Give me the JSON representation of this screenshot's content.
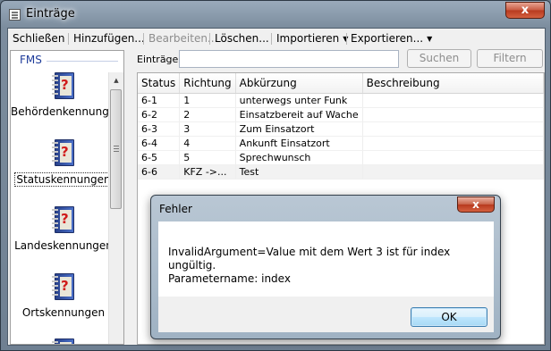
{
  "window": {
    "title": "Einträge",
    "close_glyph": "x"
  },
  "menu": {
    "items": [
      {
        "label": "Schließen",
        "enabled": true
      },
      {
        "label": "Hinzufügen...",
        "enabled": true
      },
      {
        "label": "Bearbeiten...",
        "enabled": false
      },
      {
        "label": "Löschen...",
        "enabled": true
      },
      {
        "label": "Importieren",
        "enabled": true
      },
      {
        "label": "Exportieren...",
        "enabled": true
      }
    ]
  },
  "sidebar": {
    "header": "FMS",
    "items": [
      {
        "label": "Behördenkennungen",
        "selected": false
      },
      {
        "label": "Statuskennungen",
        "selected": true
      },
      {
        "label": "Landeskennungen",
        "selected": false
      },
      {
        "label": "Ortskennungen",
        "selected": false
      }
    ]
  },
  "search": {
    "label": "Einträge:",
    "value": "",
    "search_button": "Suchen",
    "filter_button": "Filtern"
  },
  "table": {
    "columns": [
      "Status",
      "Richtung",
      "Abkürzung",
      "Beschreibung"
    ],
    "rows": [
      [
        "6-1",
        "1",
        "unterwegs unter Funk",
        ""
      ],
      [
        "6-2",
        "2",
        "Einsatzbereit auf Wache",
        ""
      ],
      [
        "6-3",
        "3",
        "Zum Einsatzort",
        ""
      ],
      [
        "6-4",
        "4",
        "Ankunft Einsatzort",
        ""
      ],
      [
        "6-5",
        "5",
        "Sprechwunsch",
        ""
      ],
      [
        "6-6",
        "KFZ ->...",
        "Test",
        ""
      ]
    ]
  },
  "dialog": {
    "title": "Fehler",
    "close_glyph": "x",
    "message_line1": "InvalidArgument=Value mit dem Wert 3 ist für index ungültig.",
    "message_line2": "Parametername: index",
    "ok_label": "OK"
  }
}
